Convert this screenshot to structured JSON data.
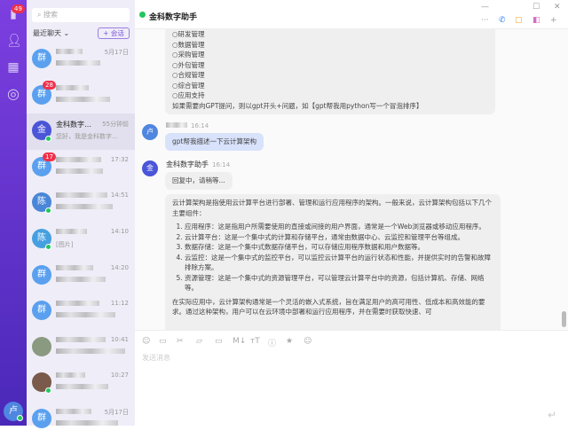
{
  "rail": {
    "badge": "49",
    "me_avatar": "卢"
  },
  "list": {
    "search_placeholder": "搜索",
    "recent_label": "最近聊天 ⌄",
    "new_chat": "+ 会话",
    "items": [
      {
        "avatar": "群",
        "time": "5月17日",
        "badge": "",
        "name": "",
        "preview": "",
        "color": "#5aa0ef"
      },
      {
        "avatar": "群",
        "time": "",
        "badge": "28",
        "name": "",
        "preview": "",
        "color": "#5aa0ef"
      },
      {
        "avatar": "金",
        "time": "55分钟前",
        "badge": "",
        "name": "金科数字…",
        "preview": "您好，我是金科数字…",
        "color": "#4a55d8",
        "online": true
      },
      {
        "avatar": "群",
        "time": "17:32",
        "badge": "17",
        "name": "",
        "preview": "",
        "color": "#5aa0ef"
      },
      {
        "avatar": "陈",
        "time": "14:51",
        "badge": "",
        "name": "",
        "preview": "",
        "color": "#4a86d8",
        "online": true
      },
      {
        "avatar": "陈",
        "time": "14:10",
        "badge": "",
        "name": "",
        "preview": "[图片]",
        "color": "#46a0e0",
        "online": true
      },
      {
        "avatar": "群",
        "time": "14:20",
        "badge": "",
        "name": "",
        "preview": "",
        "color": "#5aa0ef"
      },
      {
        "avatar": "群",
        "time": "11:12",
        "badge": "",
        "name": "",
        "preview": "",
        "color": "#5aa0ef"
      },
      {
        "avatar": "",
        "time": "10:41",
        "badge": "",
        "name": "",
        "preview": "",
        "color": "#8a9a80"
      },
      {
        "avatar": "",
        "time": "10:27",
        "badge": "",
        "name": "",
        "preview": "",
        "color": "#7a5a4a",
        "online": true
      },
      {
        "avatar": "群",
        "time": "5月17日",
        "badge": "",
        "name": "",
        "preview": "",
        "color": "#5aa0ef"
      }
    ]
  },
  "chat": {
    "title": "金科数字助手",
    "intro_lines": [
      "○研发管理",
      "○数据管理",
      "○采购管理",
      "○外包管理",
      "○合规管理",
      "○综合管理",
      "○应用支持",
      "如果需要向GPT提问，则以gpt开头+问题，如【gpt帮我用python写一个冒泡排序】"
    ],
    "user_msg": {
      "avatar": "卢",
      "time": "16:14",
      "text": "gpt帮我描述一下云计算架构"
    },
    "bot": {
      "avatar": "金",
      "name": "金科数字助手",
      "time": "16:14",
      "waiting": "回复中，请稍等...",
      "intro": "云计算架构是指使用云计算平台进行部署、管理和运行应用程序的架构。一般来说，云计算架构包括以下几个主要组件：",
      "points": [
        "应用程序：这是指用户所需要使用的直接或间接的用户界面，通常是一个Web浏览器或移动应用程序。",
        "云计算平台：这是一个集中式的计算和存储平台，通常由数据中心、云监控和管理平台等组成。",
        "数据存储：这是一个集中式数据存储平台，可以存储应用程序数据和用户数据等。",
        "云监控：这是一个集中式的监控平台，可以监控云计算平台的运行状态和性能，并提供实时的告警和故障排除方案。",
        "资源管理：这是一个集中式的资源管理平台，可以管理云计算平台中的资源，包括计算机、存储、网络等。"
      ],
      "outro": "在实际应用中，云计算架构通常是一个灵活的嵌入式系统，旨在满足用户的高可用性、低成本和高效能的要求。通过这种架构，用户可以在云环境中部署和运行应用程序，并在需要时获取快速、可"
    }
  },
  "input": {
    "placeholder": "发送消息"
  }
}
